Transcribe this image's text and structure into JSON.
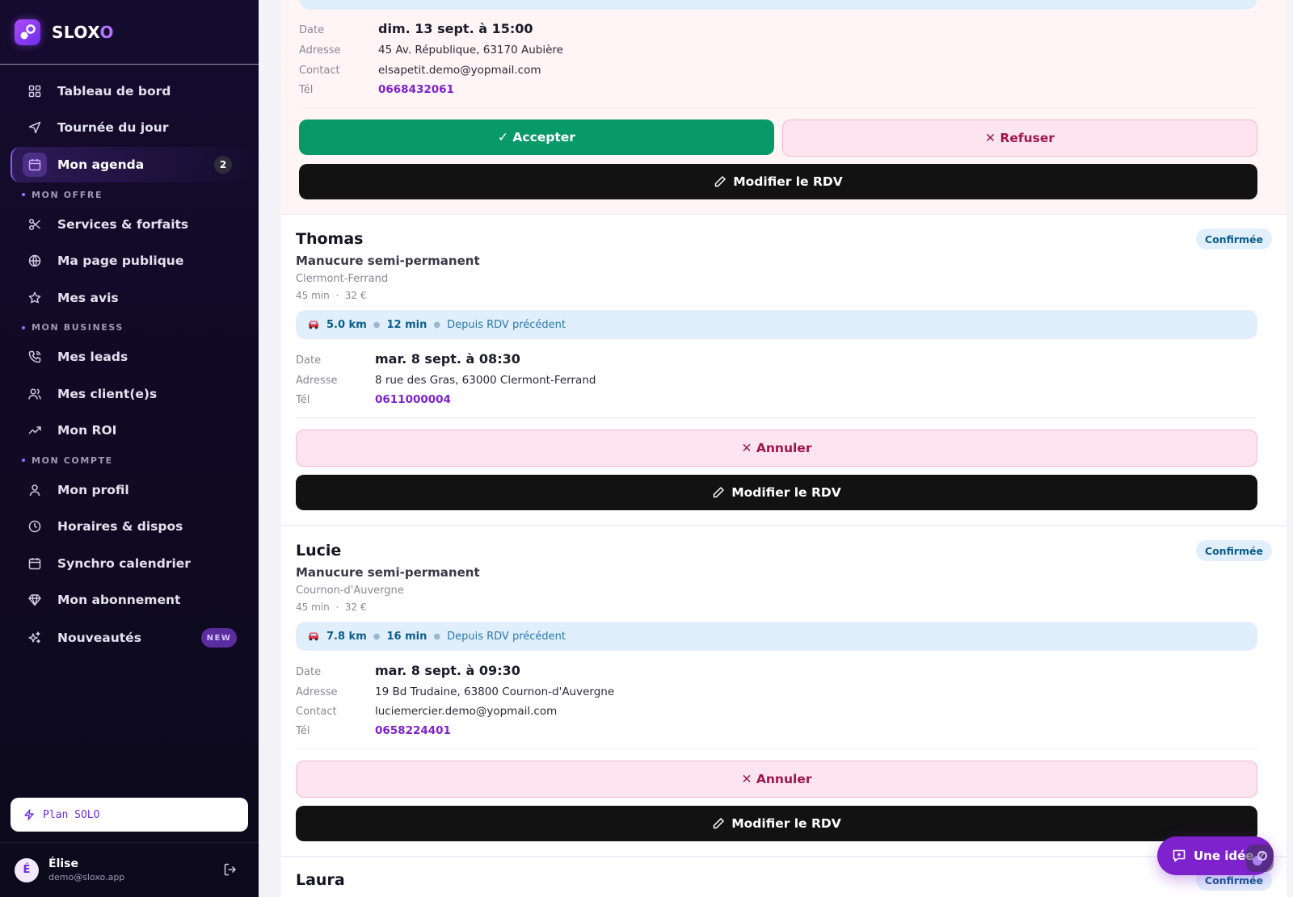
{
  "brand": {
    "name_main": "SLOX",
    "name_end": "O"
  },
  "sidebar": {
    "items": [
      {
        "label": "Tableau de bord"
      },
      {
        "label": "Tournée du jour"
      },
      {
        "label": "Mon agenda",
        "badge": "2"
      }
    ],
    "sections": [
      {
        "title": "MON OFFRE",
        "items": [
          {
            "label": "Services & forfaits"
          },
          {
            "label": "Ma page publique"
          },
          {
            "label": "Mes avis"
          }
        ]
      },
      {
        "title": "MON BUSINESS",
        "items": [
          {
            "label": "Mes leads"
          },
          {
            "label": "Mes client(e)s"
          },
          {
            "label": "Mon ROI"
          }
        ]
      },
      {
        "title": "MON COMPTE",
        "items": [
          {
            "label": "Mon profil"
          },
          {
            "label": "Horaires & dispos"
          },
          {
            "label": "Synchro calendrier"
          },
          {
            "label": "Mon abonnement"
          },
          {
            "label": "Nouveautés",
            "badge": "NEW"
          }
        ]
      }
    ],
    "plan": "Plan SOLO",
    "user": {
      "initial": "É",
      "name": "Élise",
      "email": "demo@sloxo.app"
    }
  },
  "labels": {
    "date": "Date",
    "address": "Adresse",
    "contact": "Contact",
    "tel": "Tél"
  },
  "buttons": {
    "accept": "✓ Accepter",
    "refuse": "✕ Refuser",
    "edit": "Modifier le RDV",
    "cancel": "✕ Annuler"
  },
  "appointments": [
    {
      "date": "dim. 13 sept. à 15:00",
      "address": "45 Av. République, 63170 Aubière",
      "contact": "elsapetit.demo@yopmail.com",
      "tel": "0668432061"
    },
    {
      "name": "Thomas",
      "status": "Confirmée",
      "service": "Manucure semi-permanent",
      "city": "Clermont-Ferrand",
      "duration": "45 min",
      "price": "32 €",
      "route": {
        "km": "5.0 km",
        "min": "12 min",
        "since": "Depuis RDV précédent"
      },
      "date": "mar. 8 sept. à 08:30",
      "address": "8 rue des Gras, 63000 Clermont-Ferrand",
      "tel": "0611000004"
    },
    {
      "name": "Lucie",
      "status": "Confirmée",
      "service": "Manucure semi-permanent",
      "city": "Cournon-d'Auvergne",
      "duration": "45 min",
      "price": "32 €",
      "route": {
        "km": "7.8 km",
        "min": "16 min",
        "since": "Depuis RDV précédent"
      },
      "date": "mar. 8 sept. à 09:30",
      "address": "19 Bd Trudaine, 63800 Cournon-d'Auvergne",
      "contact": "luciemercier.demo@yopmail.com",
      "tel": "0658224401"
    },
    {
      "name": "Laura",
      "status": "Confirmée"
    }
  ],
  "fab": {
    "label": "Une idée ?"
  }
}
